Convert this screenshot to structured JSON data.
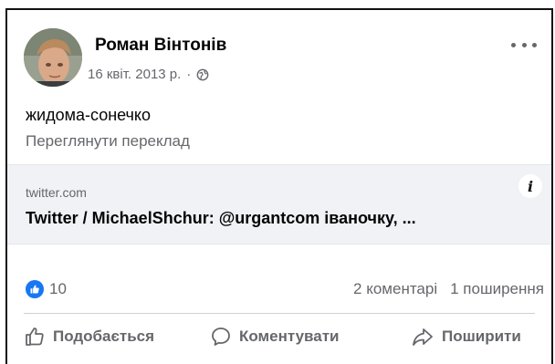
{
  "post": {
    "author": "Роман Вінтонів",
    "date": "16 квіт. 2013 р.",
    "privacy_icon": "globe-icon",
    "text": "жидома-сонечко",
    "translate_link": "Переглянути переклад"
  },
  "link_preview": {
    "domain": "twitter.com",
    "title": "Twitter / MichaelShchur: @urgantcom іваночку, ..."
  },
  "stats": {
    "likes": "10",
    "comments": "2 коментарі",
    "shares": "1 поширення"
  },
  "actions": {
    "like": "Подобається",
    "comment": "Коментувати",
    "share": "Поширити"
  },
  "colors": {
    "accent": "#1877f2",
    "muted": "#65676b",
    "preview_bg": "#f0f2f5"
  }
}
